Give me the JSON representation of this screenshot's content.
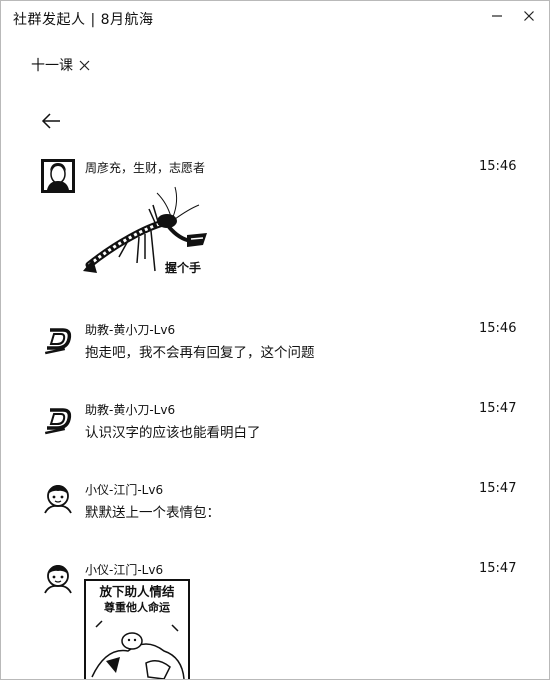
{
  "window": {
    "title": "社群发起人 | 8月航海"
  },
  "tabbar": {
    "tab_label": "十一课"
  },
  "messages": [
    {
      "sender": "周彦充，生财，志愿者",
      "time": "15:46",
      "sticker_caption": "握个手"
    },
    {
      "sender": "助教-黄小刀-Lv6",
      "time": "15:46",
      "text": "抱走吧，我不会再有回复了，这个问题"
    },
    {
      "sender": "助教-黄小刀-Lv6",
      "time": "15:47",
      "text": "认识汉字的应该也能看明白了"
    },
    {
      "sender": "小仪-江门-Lv6",
      "time": "15:47",
      "text": "默默送上一个表情包："
    },
    {
      "sender": "小仪-江门-Lv6",
      "time": "15:47",
      "meme_line1": "放下助人情结",
      "meme_line2": "尊重他人命运"
    }
  ],
  "icons": {
    "minimize": "minimize-icon",
    "close": "close-icon",
    "tab_close": "tab-close-icon",
    "back": "arrow-left-icon"
  }
}
